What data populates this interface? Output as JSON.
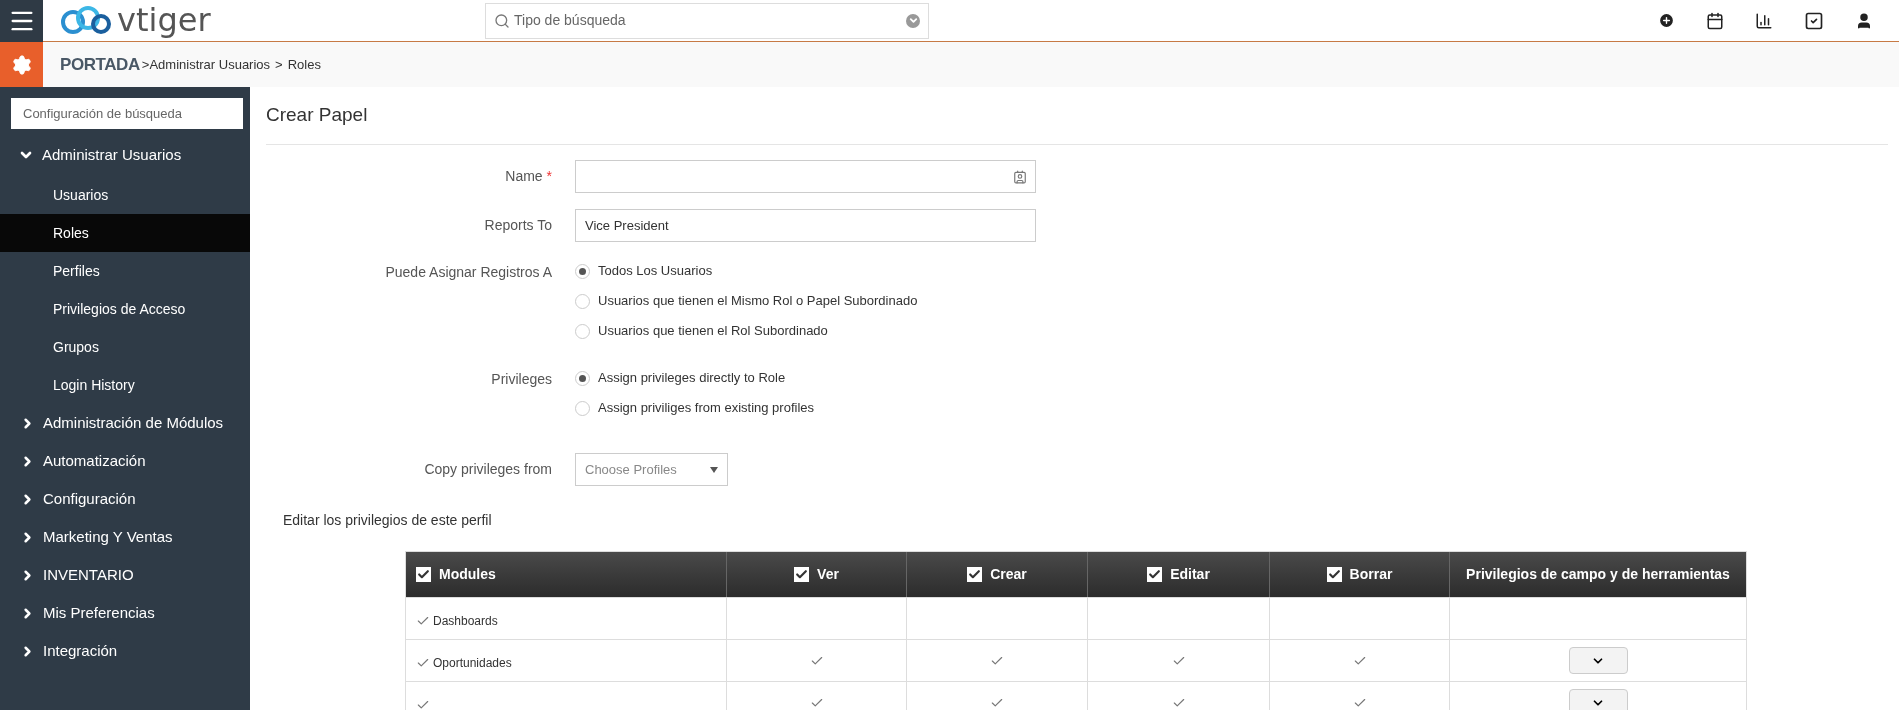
{
  "header": {
    "logo_text": "vtiger",
    "search_placeholder": "Tipo de búsqueda"
  },
  "breadcrumb": {
    "home": "PORTADA",
    "items": [
      ">Administrar Usuarios",
      ">",
      "Roles"
    ]
  },
  "sidebar": {
    "search_placeholder": "Configuración de búsqueda",
    "groups": [
      {
        "label": "Administrar Usuarios",
        "expanded": true,
        "children": [
          {
            "label": "Usuarios",
            "selected": false
          },
          {
            "label": "Roles",
            "selected": true
          },
          {
            "label": "Perfiles",
            "selected": false
          },
          {
            "label": "Privilegios de Acceso",
            "selected": false
          },
          {
            "label": "Grupos",
            "selected": false
          },
          {
            "label": "Login History",
            "selected": false
          }
        ]
      },
      {
        "label": "Administración de Módulos",
        "expanded": false
      },
      {
        "label": "Automatización",
        "expanded": false
      },
      {
        "label": "Configuración",
        "expanded": false
      },
      {
        "label": "Marketing Y Ventas",
        "expanded": false
      },
      {
        "label": "INVENTARIO",
        "expanded": false
      },
      {
        "label": "Mis Preferencias",
        "expanded": false
      },
      {
        "label": "Integración",
        "expanded": false
      }
    ]
  },
  "form": {
    "title": "Crear Papel",
    "name": {
      "label": "Name",
      "required_mark": "*"
    },
    "reports_to": {
      "label": "Reports To",
      "value": "Vice President"
    },
    "assign": {
      "label": "Puede Asignar Registros A",
      "options": [
        {
          "label": "Todos Los Usuarios",
          "selected": true
        },
        {
          "label": "Usuarios que tienen el Mismo Rol o Papel Subordinado",
          "selected": false
        },
        {
          "label": "Usuarios que tienen el Rol Subordinado",
          "selected": false
        }
      ]
    },
    "privileges": {
      "label": "Privileges",
      "options": [
        {
          "label": "Assign privileges directly to Role",
          "selected": true
        },
        {
          "label": "Assign priviliges from existing profiles",
          "selected": false
        }
      ]
    },
    "copy_from": {
      "label": "Copy privileges from",
      "placeholder": "Choose Profiles"
    },
    "section_title": "Editar los privilegios de este perfil"
  },
  "table": {
    "columns": [
      {
        "label": "Modules",
        "checked": true
      },
      {
        "label": "Ver",
        "checked": true
      },
      {
        "label": "Crear",
        "checked": true
      },
      {
        "label": "Editar",
        "checked": true
      },
      {
        "label": "Borrar",
        "checked": true
      },
      {
        "label": "Privilegios de campo y de herramientas"
      }
    ],
    "rows": [
      {
        "module": "Dashboards",
        "checked": true,
        "permissions": []
      },
      {
        "module": "Oportunidades",
        "checked": true,
        "permissions": [
          true,
          true,
          true,
          true
        ],
        "tools_button": true
      },
      {
        "checked": true,
        "permissions": [
          true,
          true,
          true,
          true
        ],
        "tools_button": true
      }
    ]
  }
}
